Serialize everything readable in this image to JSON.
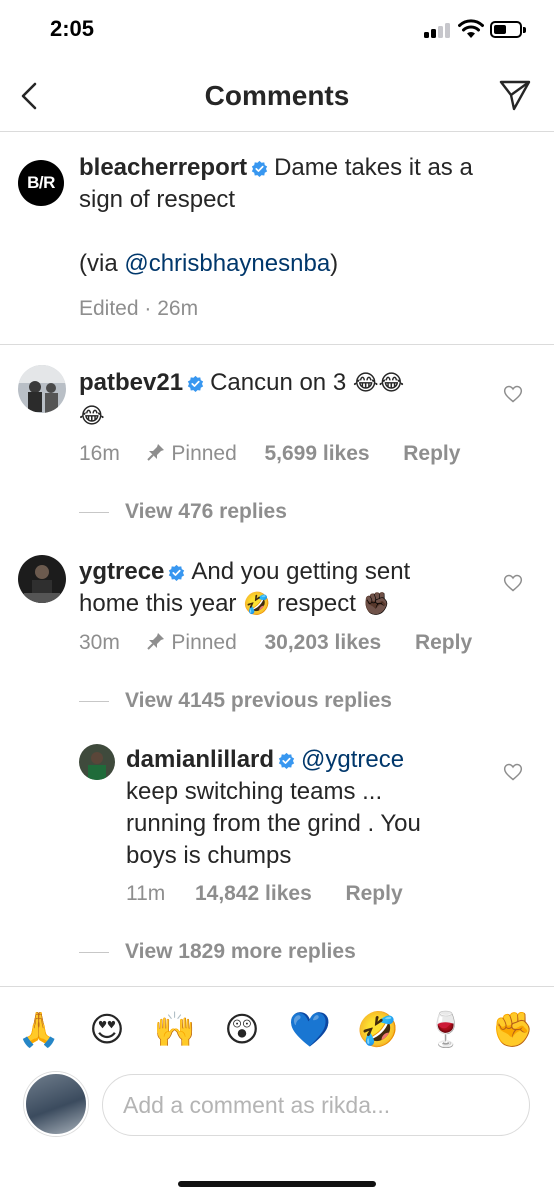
{
  "status_bar": {
    "time": "2:05"
  },
  "header": {
    "title": "Comments"
  },
  "caption": {
    "avatar_text": "B/R",
    "username": "bleacherreport",
    "text_line1": "Dame takes it as a",
    "text_line2": "sign of respect",
    "via_prefix": "(via ",
    "via_mention": "@chrisbhaynesnba",
    "via_suffix": ")",
    "meta": "Edited · 26m"
  },
  "comments": [
    {
      "username": "patbev21",
      "text_line1": "Cancun on 3",
      "emoji_line1": "😂😂",
      "emoji_line2": "😂",
      "time": "16m",
      "pinned_label": "Pinned",
      "likes": "5,699 likes",
      "reply_label": "Reply",
      "view_replies": "View 476 replies"
    },
    {
      "username": "ygtrece",
      "text_line1": "And you getting sent",
      "text_line2a": "home this year",
      "emoji_a": "🤣",
      "text_line2b": "respect",
      "emoji_b": "✊🏿",
      "time": "30m",
      "pinned_label": "Pinned",
      "likes": "30,203 likes",
      "reply_label": "Reply",
      "view_replies": "View 4145 previous replies"
    }
  ],
  "reply": {
    "username": "damianlillard",
    "mention": "@ygtrece",
    "text_line1": "keep switching teams ...",
    "text_line2": "running from the grind . You",
    "text_line3": "boys is chumps",
    "time": "11m",
    "likes": "14,842 likes",
    "reply_label": "Reply",
    "view_more": "View 1829 more replies"
  },
  "emoji_bar": [
    "🙏",
    "😍",
    "🙌",
    "😲",
    "💙",
    "🤣",
    "🍷",
    "✊"
  ],
  "composer": {
    "placeholder": "Add a comment as rikda..."
  },
  "colors": {
    "text": "#262626",
    "secondary": "#8e8e8e",
    "verified": "#3897f0",
    "mention": "#00376b",
    "divider": "#dbdbdb"
  }
}
